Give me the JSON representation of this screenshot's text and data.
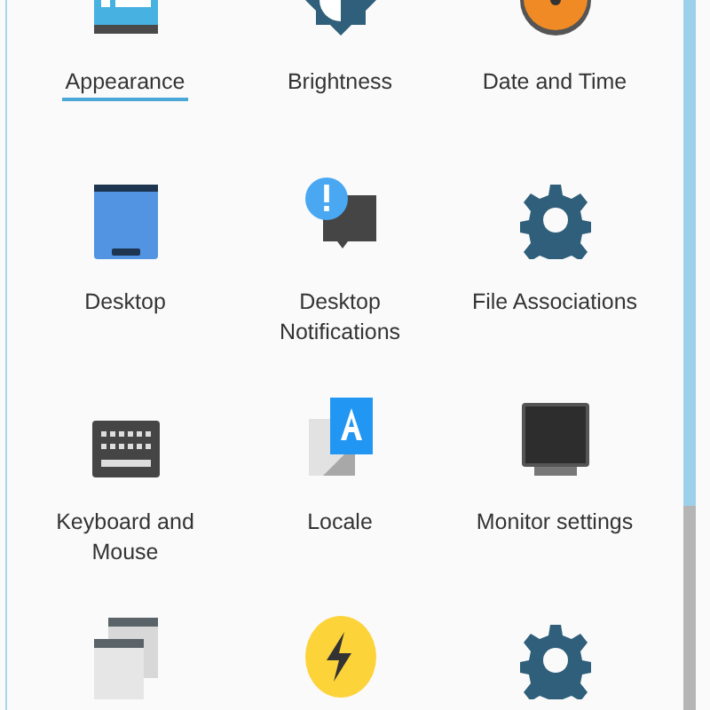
{
  "items": [
    {
      "label": "Appearance",
      "kind": "appearance",
      "selected": true
    },
    {
      "label": "Brightness",
      "kind": "brightness",
      "selected": false
    },
    {
      "label": "Date and Time",
      "kind": "clock",
      "selected": false
    },
    {
      "label": "Desktop",
      "kind": "desktop",
      "selected": false
    },
    {
      "label": "Desktop Notifications",
      "kind": "notification",
      "selected": false
    },
    {
      "label": "File Associations",
      "kind": "gear",
      "selected": false
    },
    {
      "label": "Keyboard and Mouse",
      "kind": "keyboard",
      "selected": false
    },
    {
      "label": "Locale",
      "kind": "locale",
      "selected": false
    },
    {
      "label": "Monitor settings",
      "kind": "monitor",
      "selected": false
    },
    {
      "kind": "windows"
    },
    {
      "kind": "power"
    },
    {
      "kind": "gear"
    }
  ]
}
